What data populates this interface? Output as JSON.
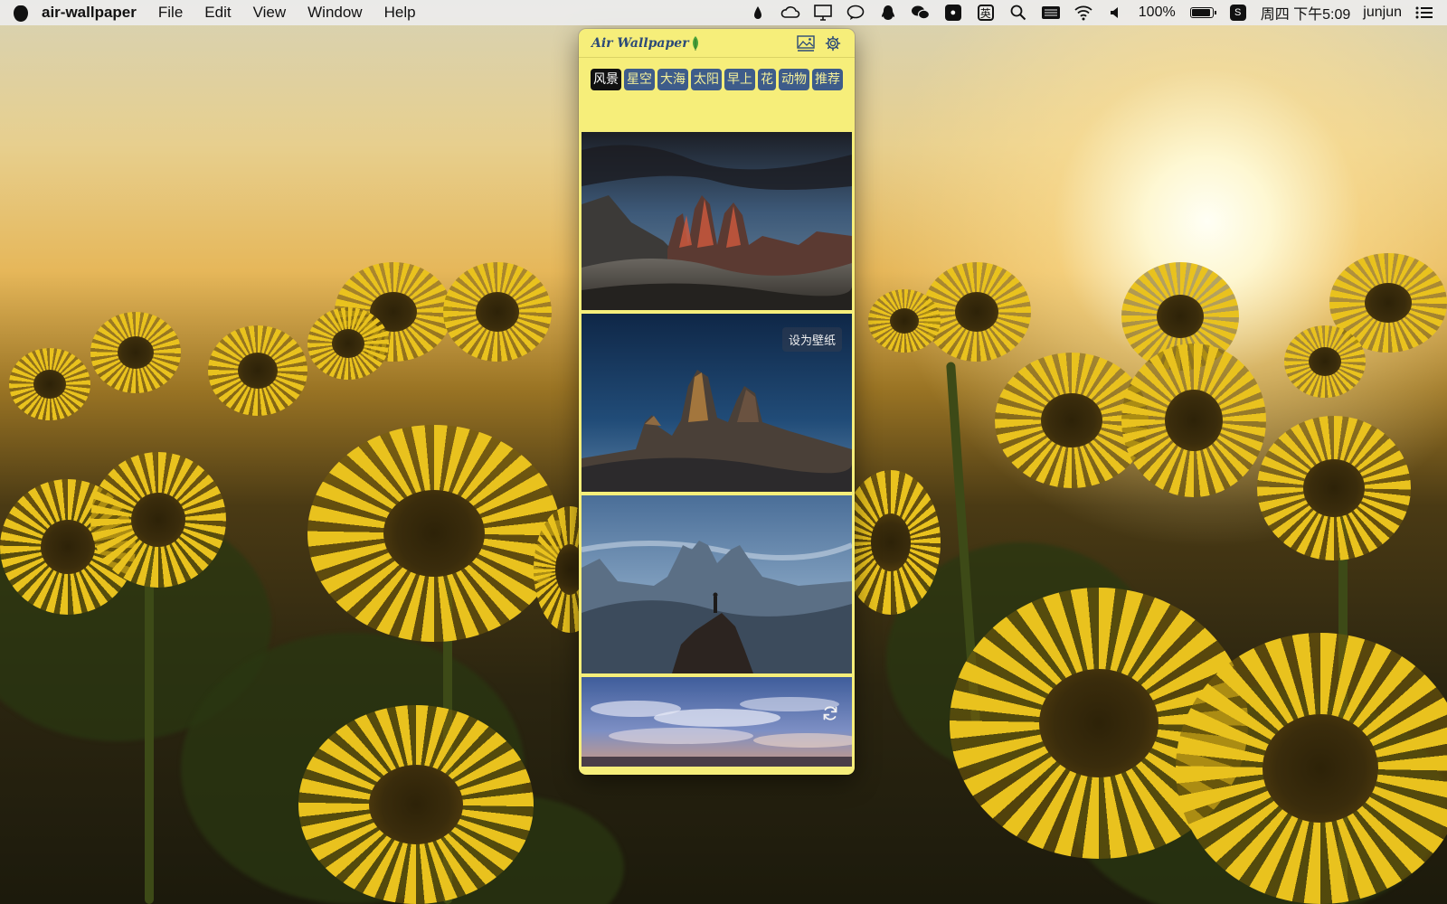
{
  "menubar": {
    "app_name": "air-wallpaper",
    "menus": [
      "File",
      "Edit",
      "View",
      "Window",
      "Help"
    ],
    "battery_percent": "100%",
    "input_method": "英",
    "clock": "周四 下午5:09",
    "user": "junjun",
    "status_icons": [
      "ink-drop-icon",
      "creative-cloud-icon",
      "display-icon",
      "chat-icon",
      "qq-penguin-icon",
      "wechat-icon",
      "microphone-icon",
      "input-method-icon",
      "search-icon",
      "keyboard-icon",
      "wifi-icon",
      "volume-icon",
      "battery-icon",
      "sogou-icon",
      "list-icon"
    ]
  },
  "app": {
    "title": "Air Wallpaper",
    "background_color": "#f6ee7a",
    "accent_color": "#3e5c8a",
    "header_buttons": [
      "gallery-icon",
      "settings-gear-icon"
    ],
    "tabs": [
      {
        "label": "风景",
        "active": true
      },
      {
        "label": "星空",
        "active": false
      },
      {
        "label": "大海",
        "active": false
      },
      {
        "label": "太阳",
        "active": false
      },
      {
        "label": "早上",
        "active": false
      },
      {
        "label": "花",
        "active": false
      },
      {
        "label": "动物",
        "active": false
      },
      {
        "label": "推荐",
        "active": false
      }
    ],
    "set_wallpaper_label": "设为壁纸",
    "refresh_icon": "refresh-icon"
  }
}
